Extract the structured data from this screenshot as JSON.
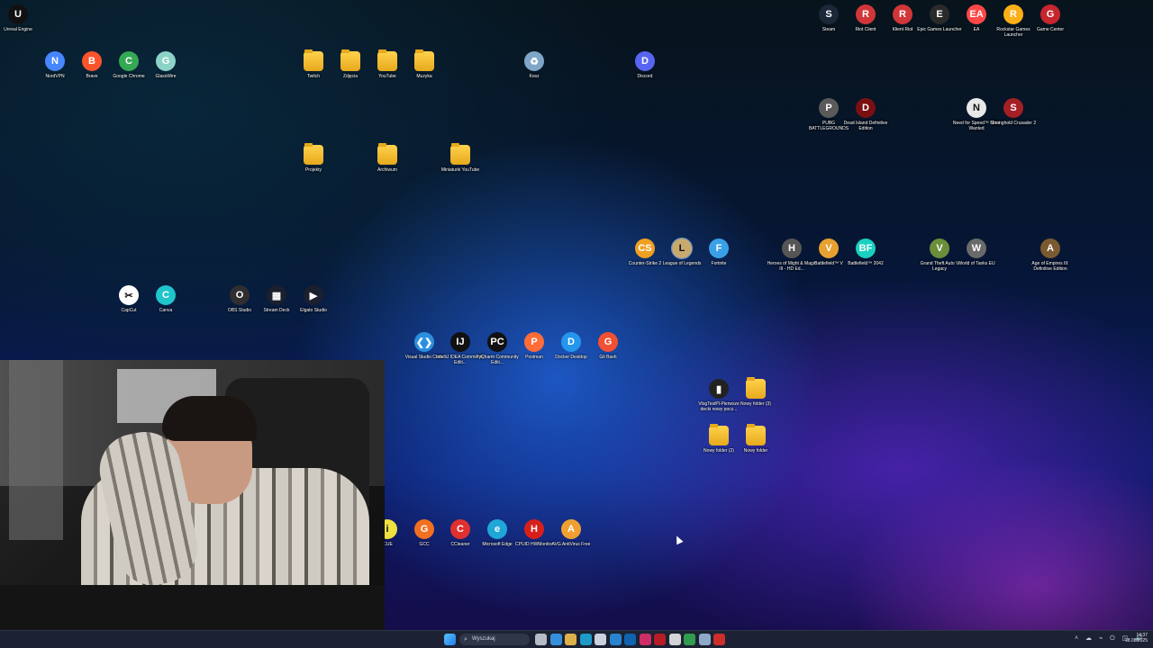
{
  "desktop": {
    "icons": [
      {
        "label": "Unreal Engine",
        "icon": "unreal-engine-icon",
        "color": "#111111",
        "glyph": "U"
      },
      {
        "label": "NordVPN",
        "icon": "nordvpn-icon",
        "color": "#4687ff",
        "glyph": "N"
      },
      {
        "label": "Brave",
        "icon": "brave-icon",
        "color": "#fb542b",
        "glyph": "B"
      },
      {
        "label": "Google Chrome",
        "icon": "chrome-icon",
        "color": "#34a853",
        "glyph": "C"
      },
      {
        "label": "GlassWire",
        "icon": "glasswire-icon",
        "color": "#8bd3c7",
        "glyph": "G"
      },
      {
        "label": "Twitch",
        "icon": "folder-icon",
        "color": "#f2b632",
        "glyph": ""
      },
      {
        "label": "Zdjęcia",
        "icon": "folder-icon",
        "color": "#f2b632",
        "glyph": ""
      },
      {
        "label": "YouTube",
        "icon": "folder-icon",
        "color": "#f2b632",
        "glyph": ""
      },
      {
        "label": "Muzyka",
        "icon": "folder-icon",
        "color": "#f2b632",
        "glyph": ""
      },
      {
        "label": "Kosz",
        "icon": "recycle-bin-icon",
        "color": "#7fa6c9",
        "glyph": "♻"
      },
      {
        "label": "Discord",
        "icon": "discord-icon",
        "color": "#5865f2",
        "glyph": "D"
      },
      {
        "label": "Projekty",
        "icon": "folder-icon",
        "color": "#f2b632",
        "glyph": ""
      },
      {
        "label": "Archiwum",
        "icon": "folder-icon",
        "color": "#f2b632",
        "glyph": ""
      },
      {
        "label": "Miniaturki YouTube",
        "icon": "folder-icon",
        "color": "#f2b632",
        "glyph": ""
      },
      {
        "label": "Steam",
        "icon": "steam-icon",
        "color": "#1b2838",
        "glyph": "S"
      },
      {
        "label": "Riot Client",
        "icon": "riot-client-icon",
        "color": "#d13639",
        "glyph": "R"
      },
      {
        "label": "Klient Riot",
        "icon": "riot-client-icon",
        "color": "#d13639",
        "glyph": "R"
      },
      {
        "label": "Epic Games Launcher",
        "icon": "epic-games-icon",
        "color": "#2a2a2a",
        "glyph": "E"
      },
      {
        "label": "EA",
        "icon": "ea-icon",
        "color": "#ff4747",
        "glyph": "EA"
      },
      {
        "label": "Rockstar Games Launcher",
        "icon": "rockstar-icon",
        "color": "#fcaf17",
        "glyph": "R"
      },
      {
        "label": "Game Center",
        "icon": "game-center-icon",
        "color": "#c6262e",
        "glyph": "G"
      },
      {
        "label": "PUBG BATTLEGROUNDS",
        "icon": "pubg-icon",
        "color": "#5a5a5a",
        "glyph": "P"
      },
      {
        "label": "Dead Island Definitive Edition",
        "icon": "dead-island-icon",
        "color": "#7a0f12",
        "glyph": "D"
      },
      {
        "label": "Need for Speed™ Most Wanted",
        "icon": "nfs-icon",
        "color": "#e8e8e8",
        "glyph": "N"
      },
      {
        "label": "Stronghold Crusader 2",
        "icon": "stronghold-icon",
        "color": "#a51f24",
        "glyph": "S"
      },
      {
        "label": "Counter-Strike 2",
        "icon": "cs2-icon",
        "color": "#f0a020",
        "glyph": "CS"
      },
      {
        "label": "League of Legends",
        "icon": "lol-icon",
        "color": "#c8aa6e",
        "glyph": "L"
      },
      {
        "label": "Fortnite",
        "icon": "fortnite-icon",
        "color": "#3aa0e8",
        "glyph": "F"
      },
      {
        "label": "Heroes of Might & Magic III - HD Ed...",
        "icon": "homm3-icon",
        "color": "#555555",
        "glyph": "H"
      },
      {
        "label": "Battlefield™ V",
        "icon": "bfv-icon",
        "color": "#e8a030",
        "glyph": "V"
      },
      {
        "label": "Battlefield™ 2042",
        "icon": "bf2042-icon",
        "color": "#19d0c0",
        "glyph": "BF"
      },
      {
        "label": "Grand Theft Auto V Legacy",
        "icon": "gta5-icon",
        "color": "#6b8e3a",
        "glyph": "V"
      },
      {
        "label": "World of Tanks EU",
        "icon": "wot-icon",
        "color": "#6a6a6a",
        "glyph": "W"
      },
      {
        "label": "Age of Empires III: Definitive Edition",
        "icon": "aoe3-icon",
        "color": "#7a5a30",
        "glyph": "A"
      },
      {
        "label": "CapCut",
        "icon": "capcut-icon",
        "color": "#ffffff",
        "glyph": "✂"
      },
      {
        "label": "Canva",
        "icon": "canva-icon",
        "color": "#20c4cb",
        "glyph": "C"
      },
      {
        "label": "OBS Studio",
        "icon": "obs-icon",
        "color": "#302e31",
        "glyph": "O"
      },
      {
        "label": "Stream Deck",
        "icon": "stream-deck-icon",
        "color": "#1b1f2e",
        "glyph": "▦"
      },
      {
        "label": "Elgato Studio",
        "icon": "elgato-icon",
        "color": "#1b1f2e",
        "glyph": "▶"
      },
      {
        "label": "Visual Studio Code",
        "icon": "vscode-icon",
        "color": "#2b8fe0",
        "glyph": "❮❯"
      },
      {
        "label": "IntelliJ IDEA Community Editi...",
        "icon": "intellij-icon",
        "color": "#111111",
        "glyph": "IJ"
      },
      {
        "label": "PyCharm Community Editi...",
        "icon": "pycharm-icon",
        "color": "#111111",
        "glyph": "PC"
      },
      {
        "label": "Postman",
        "icon": "postman-icon",
        "color": "#ff6c37",
        "glyph": "P"
      },
      {
        "label": "Docker Desktop",
        "icon": "docker-icon",
        "color": "#2496ed",
        "glyph": "D"
      },
      {
        "label": "Git Bash",
        "icon": "git-bash-icon",
        "color": "#f05033",
        "glyph": "G"
      },
      {
        "label": "VlogTestPl-Pierwsze decki nowy pocz...",
        "icon": "video-file-icon",
        "color": "#222222",
        "glyph": "▮"
      },
      {
        "label": "Nowy folder (3)",
        "icon": "folder-icon",
        "color": "#f2b632",
        "glyph": ""
      },
      {
        "label": "Nowy folder (2)",
        "icon": "folder-icon",
        "color": "#f2b632",
        "glyph": ""
      },
      {
        "label": "Nowy folder",
        "icon": "folder-icon",
        "color": "#f2b632",
        "glyph": ""
      },
      {
        "label": "iCUE",
        "icon": "icue-icon",
        "color": "#f0e040",
        "glyph": "i"
      },
      {
        "label": "GCC",
        "icon": "gcc-icon",
        "color": "#f07020",
        "glyph": "G"
      },
      {
        "label": "CCleaner",
        "icon": "ccleaner-icon",
        "color": "#e03030",
        "glyph": "C"
      },
      {
        "label": "Microsoft Edge",
        "icon": "edge-icon",
        "color": "#1fa7d8",
        "glyph": "e"
      },
      {
        "label": "CPUID HWMonitor",
        "icon": "hwmonitor-icon",
        "color": "#d8201a",
        "glyph": "H"
      },
      {
        "label": "AVG AntiVirus Free",
        "icon": "avg-icon",
        "color": "#f0a030",
        "glyph": "A"
      }
    ]
  },
  "taskbar": {
    "start_icon": "windows-start-icon",
    "search_placeholder": "Wyszukaj",
    "pinned": [
      {
        "icon": "task-view-icon",
        "color": "#c7cdd8"
      },
      {
        "icon": "copilot-icon",
        "color": "#3a9bf0"
      },
      {
        "icon": "file-explorer-icon",
        "color": "#f2c14e"
      },
      {
        "icon": "edge-icon",
        "color": "#1fa7d8"
      },
      {
        "icon": "store-icon",
        "color": "#dfe6f0"
      },
      {
        "icon": "vscode-icon",
        "color": "#2b8fe0"
      },
      {
        "icon": "outlook-icon",
        "color": "#0f6cbd"
      },
      {
        "icon": "instagram-icon",
        "color": "#e1306c"
      },
      {
        "icon": "red-app-icon",
        "color": "#c81d25"
      },
      {
        "icon": "document-icon",
        "color": "#e8e8e8"
      },
      {
        "icon": "chrome-icon",
        "color": "#34a853"
      },
      {
        "icon": "check-app-icon",
        "color": "#9bb8d8"
      },
      {
        "icon": "recording-app-icon",
        "color": "#e0302a"
      }
    ],
    "time": "14:37",
    "date": "18.08.2025"
  }
}
